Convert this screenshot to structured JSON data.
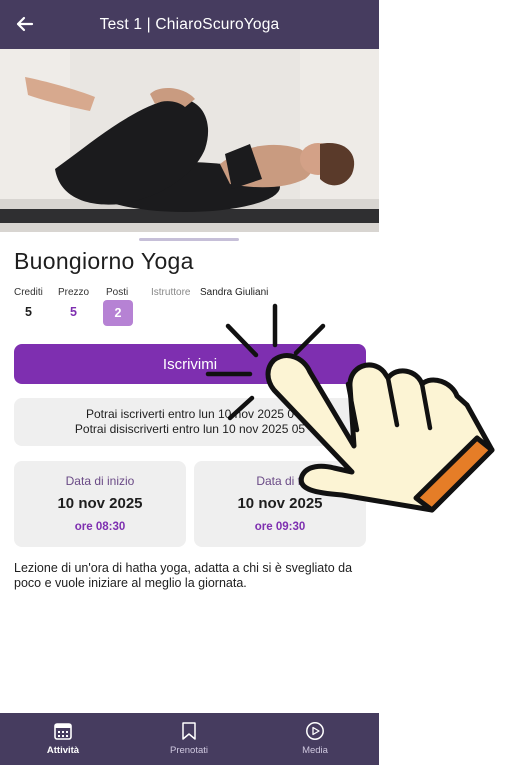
{
  "header": {
    "title": "Test 1 | ChiaroScuroYoga"
  },
  "class": {
    "name": "Buongiorno Yoga",
    "crediti_label": "Crediti",
    "crediti_value": "5",
    "prezzo_label": "Prezzo",
    "prezzo_value": "5",
    "posti_label": "Posti",
    "posti_value": "2",
    "istruttore_label": "Istruttore",
    "istruttore_value": "Sandra Giuliani"
  },
  "actions": {
    "subscribe_label": "Iscrivimi"
  },
  "info": {
    "line1": "Potrai iscriverti entro lun 10 nov 2025 0",
    "line2": "Potrai disiscriverti entro lun 10 nov 2025 05"
  },
  "start": {
    "label": "Data di inizio",
    "date": "10 nov 2025",
    "time": "ore 08:30"
  },
  "end": {
    "label": "Data di fi",
    "date": "10 nov 2025",
    "time": "ore 09:30"
  },
  "description": "Lezione di un'ora di hatha yoga, adatta a chi si è svegliato da poco e vuole iniziare al meglio la giornata.",
  "tabs": [
    {
      "label": "Attività",
      "icon": "calendar-icon"
    },
    {
      "label": "Prenotati",
      "icon": "bookmark-icon"
    },
    {
      "label": "Media",
      "icon": "play-circle-icon"
    }
  ],
  "colors": {
    "header": "#463c5f",
    "accent": "#7e2fb0",
    "badge": "#b682d4"
  }
}
